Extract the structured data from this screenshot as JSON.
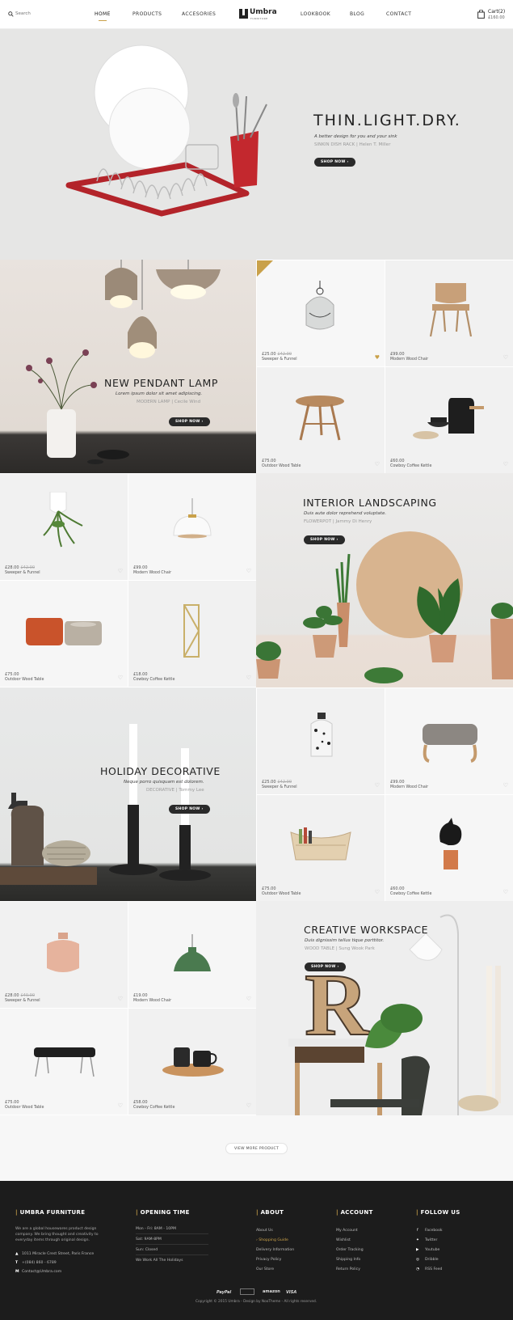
{
  "header": {
    "search_placeholder": "Search",
    "nav": [
      "HOME",
      "PRODUCTS",
      "ACCESORIES",
      "LOOKBOOK",
      "BLOG",
      "CONTACT"
    ],
    "logo_name": "Umbra",
    "logo_sub": "FURNITURE",
    "cart_label": "Cart",
    "cart_count": "(2)",
    "cart_total": "£160.00"
  },
  "hero": {
    "title": "THIN.LIGHT.DRY.",
    "subtitle": "A better design for you and your sink",
    "meta": "SINKIN DISH RACK | Helen T. Miller",
    "button": "SHOP NOW ›"
  },
  "banners": [
    {
      "title": "NEW PENDANT LAMP",
      "subtitle": "Lorem ipsum dolor sit amet adipiscing.",
      "meta": "MODERN LAMP | Cecile Wind",
      "button": "SHOP NOW ›"
    },
    {
      "title": "INTERIOR LANDSCAPING",
      "subtitle": "Duis aute dolor reprehend voluptate.",
      "meta": "FLOWERPOT | Jammy Di Henry",
      "button": "SHOP NOW ›"
    },
    {
      "title": "HOLIDAY DECORATIVE",
      "subtitle": "Neque porro quisquam est dolorem.",
      "meta": "DECORATIVE | Tommy Lee",
      "button": "SHOP NOW ›"
    },
    {
      "title": "CREATIVE WORKSPACE",
      "subtitle": "Duis dignissim tellus tique porttitor.",
      "meta": "WOOD TABLE | Sung Wook Park",
      "button": "SHOP NOW ›",
      "letter": "R"
    }
  ],
  "products": [
    {
      "price": "£25.00",
      "old": "£42.00",
      "name": "Sweeper & Funnel",
      "fav": true
    },
    {
      "price": "£99.00",
      "old": "",
      "name": "Modern Wood Chair",
      "fav": false
    },
    {
      "price": "£75.00",
      "old": "",
      "name": "Outdoor Wood Table",
      "fav": false
    },
    {
      "price": "£60.00",
      "old": "",
      "name": "Cowboy Coffee Kettle",
      "fav": false
    },
    {
      "price": "£28.00",
      "old": "£42.00",
      "name": "Sweeper & Funnel",
      "fav": false
    },
    {
      "price": "£99.00",
      "old": "",
      "name": "Modern Wood Chair",
      "fav": false
    },
    {
      "price": "£75.00",
      "old": "",
      "name": "Outdoor Wood Table",
      "fav": false
    },
    {
      "price": "£18.00",
      "old": "",
      "name": "Cowboy Coffee Kettle",
      "fav": false
    },
    {
      "price": "£25.00",
      "old": "£42.00",
      "name": "Sweeper & Funnel",
      "fav": false
    },
    {
      "price": "£99.00",
      "old": "",
      "name": "Modern Wood Chair",
      "fav": false
    },
    {
      "price": "£75.00",
      "old": "",
      "name": "Outdoor Wood Table",
      "fav": false
    },
    {
      "price": "£60.00",
      "old": "",
      "name": "Cowboy Coffee Kettle",
      "fav": false
    },
    {
      "price": "£28.00",
      "old": "£40.00",
      "name": "Sweeper & Funnel",
      "fav": false
    },
    {
      "price": "£19.00",
      "old": "",
      "name": "Modern Wood Chair",
      "fav": false
    },
    {
      "price": "£75.00",
      "old": "",
      "name": "Outdoor Wood Table",
      "fav": false
    },
    {
      "price": "£58.00",
      "old": "",
      "name": "Cowboy Coffee Kettle",
      "fav": false
    }
  ],
  "view_more": "VIEW MORE PRODUCT",
  "footer": {
    "about_brand": {
      "title": "UMBRA FURNITURE",
      "text": [
        "We are a global housewares product design",
        "company. We bring thought and creativity to",
        "everyday items through original design."
      ],
      "address": "1011 Miracle Crest Street, Paris France",
      "phone": "+(084) 860 - 6789",
      "email": "Contact@Umbra.com"
    },
    "opening": {
      "title": "OPENING TIME",
      "rows": [
        "Mon - Fri: 8AM - 10PM",
        "Sat: 9AM-8PM",
        "Sun: Closed",
        "We Work All The Holidays"
      ]
    },
    "about": {
      "title": "ABOUT",
      "links": [
        "About Us",
        "› Shopping Guide",
        "Delivery Information",
        "Privacy Policy",
        "Our Store"
      ]
    },
    "account": {
      "title": "ACCOUNT",
      "links": [
        "My Account",
        "Wishlist",
        "Order Tracking",
        "Shipping Info",
        "Return Policy"
      ]
    },
    "follow": {
      "title": "FOLLOW US",
      "links": [
        "Facebook",
        "Twitter",
        "Youtube",
        "Dribble",
        "RSS Feed"
      ]
    },
    "payments": [
      "PayPal",
      "",
      "amazon",
      "VISA"
    ],
    "copyright": "Copyright © 2015 Umbra - Design by NooTheme - All rights reserved."
  },
  "colors": {
    "accent": "#c9a14a",
    "dark": "#2a2a2a",
    "hero_bg": "#e6e6e5",
    "footer_bg": "#1c1c1c"
  }
}
